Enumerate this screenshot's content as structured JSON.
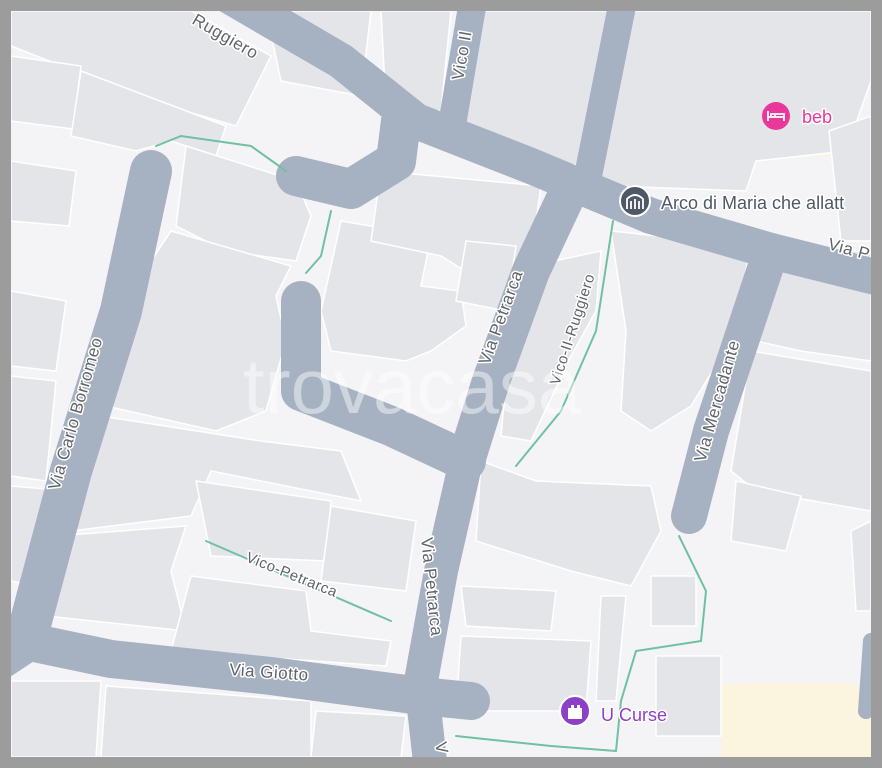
{
  "map": {
    "watermark": "trovacasa",
    "streets": {
      "via_ruggiero": "Ruggiero",
      "vico_il_top": "Vico Il",
      "via_petrarca_north": "Via Petrarca",
      "vico_ii_ruggiero": "Vico-II-Ruggiero",
      "via_mercadante": "Via Mercadante",
      "via_carlo_borromeo": "Via Carlo Borromeo",
      "vico_petrarca": "Vico-Petrarca",
      "via_petrarca_south": "Via Petrarca",
      "via_giotto": "Via Giotto",
      "via_east_cut": "Via P",
      "via_bottom_cut": "V"
    },
    "pois": [
      {
        "label": "beb",
        "icon": "bed-icon",
        "color": "#e8399a"
      },
      {
        "label": "Arco di Maria che allatt",
        "icon": "monument-icon",
        "color": "#4f5866"
      },
      {
        "label": "U Curse",
        "icon": "castle-icon",
        "color": "#8e3fc7"
      }
    ],
    "colors": {
      "background": "#f4f4f6",
      "road": "#a6b2c2",
      "building": "#e4e5e9",
      "building_edge": "#ffffff",
      "footpath": "#6fc1a1",
      "highlight_area": "#fbf4df"
    }
  }
}
